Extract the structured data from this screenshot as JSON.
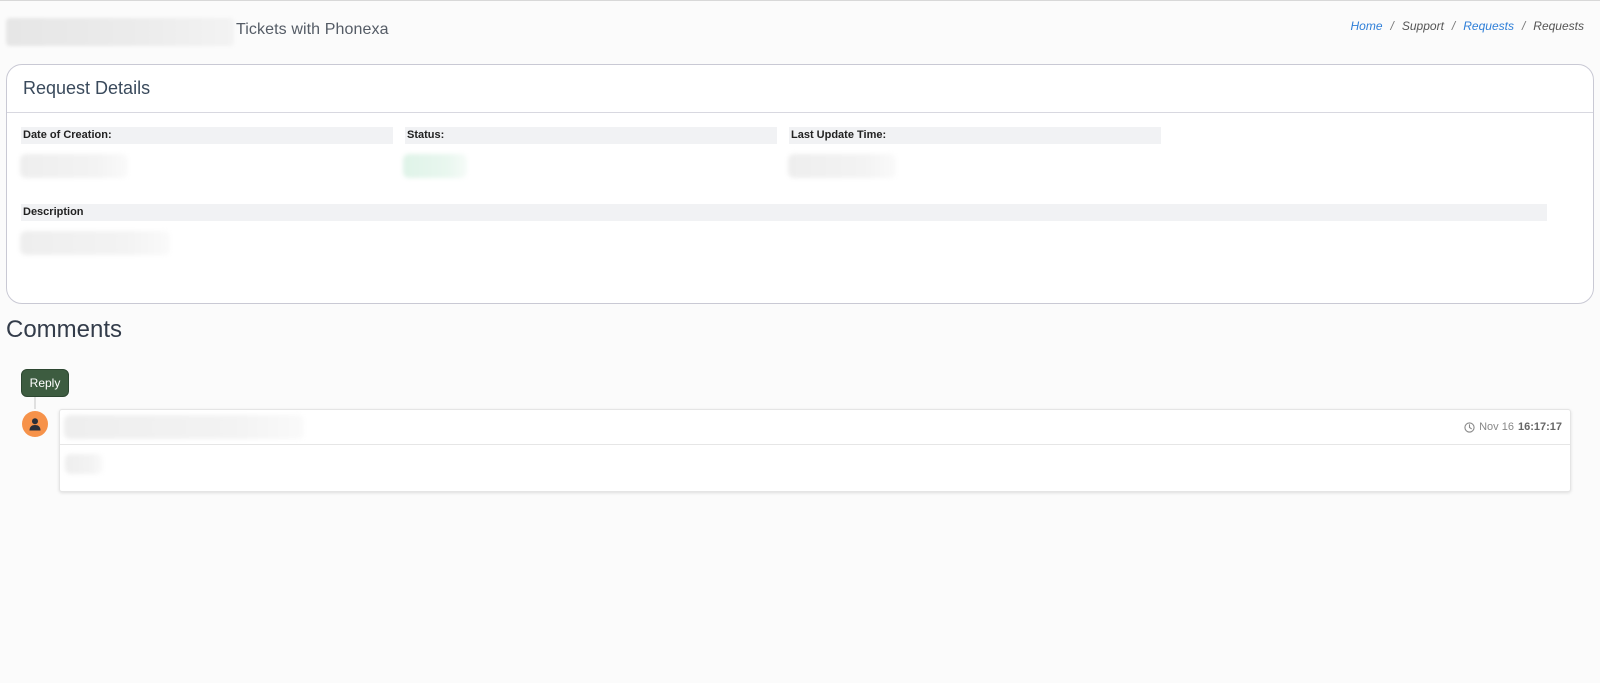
{
  "header": {
    "title": "Tickets with Phonexa",
    "breadcrumb": [
      {
        "label": "Home",
        "link": true
      },
      {
        "label": "Support",
        "link": false
      },
      {
        "label": "Requests",
        "link": true
      },
      {
        "label": "Requests",
        "link": false
      }
    ]
  },
  "details": {
    "title": "Request Details",
    "date_label": "Date of Creation:",
    "status_label": "Status:",
    "update_label": "Last Update Time:",
    "description_label": "Description"
  },
  "comments": {
    "heading": "Comments",
    "reply_label": "Reply",
    "items": [
      {
        "date": "Nov 16",
        "time": "16:17:17"
      }
    ]
  },
  "colors": {
    "reply_button": "#3d5c40",
    "avatar": "#f6924a",
    "link": "#2f7fd8"
  }
}
